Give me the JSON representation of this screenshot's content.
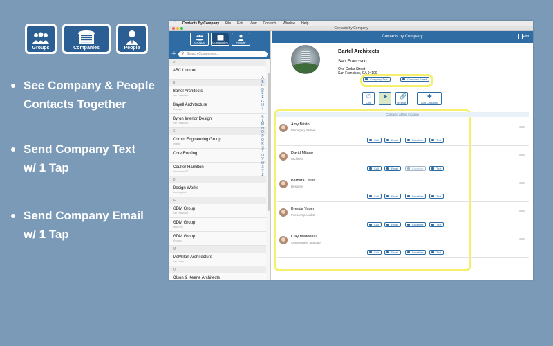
{
  "promo": {
    "icons": [
      {
        "label": "Groups",
        "icon": "groups-icon"
      },
      {
        "label": "Companies",
        "icon": "companies-icon"
      },
      {
        "label": "People",
        "icon": "people-icon"
      }
    ],
    "bullets": [
      {
        "line1": "See Company & People",
        "line2": "Contacts Together"
      },
      {
        "line1": "Send Company Text",
        "line2": "w/ 1 Tap"
      },
      {
        "line1": "Send Company Email",
        "line2": "w/ 1 Tap"
      }
    ]
  },
  "menubar": {
    "app": "Contacts By Company",
    "items": [
      "File",
      "Edit",
      "View",
      "Contacts",
      "Window",
      "Help"
    ]
  },
  "window": {
    "title": "Contacts by Company"
  },
  "sidebar": {
    "segments": [
      {
        "label": "Groups",
        "active": false
      },
      {
        "label": "Companies",
        "active": true
      },
      {
        "label": "People",
        "active": false
      }
    ],
    "search_placeholder": "Search Companies...",
    "list": [
      {
        "type": "section",
        "label": "A"
      },
      {
        "type": "row",
        "name": "ABC Lumber",
        "sub": ""
      },
      {
        "type": "section",
        "label": "B"
      },
      {
        "type": "row",
        "name": "Bartel Architects",
        "sub": "San Francisco"
      },
      {
        "type": "row",
        "name": "Bayell Architecture",
        "sub": "Chicago"
      },
      {
        "type": "row",
        "name": "Byron Interior Design",
        "sub": "San Francisco"
      },
      {
        "type": "section",
        "label": "C"
      },
      {
        "type": "row",
        "name": "Corbin Engineering Group",
        "sub": "Seattle"
      },
      {
        "type": "row",
        "name": "Core Roofing",
        "sub": ""
      },
      {
        "type": "row",
        "name": "Coulter Hamilton",
        "sub": "Vancouver, BC"
      },
      {
        "type": "section",
        "label": "D"
      },
      {
        "type": "row",
        "name": "Design Works",
        "sub": "Los Angeles"
      },
      {
        "type": "section",
        "label": "G"
      },
      {
        "type": "row",
        "name": "GDM Group",
        "sub": "San Francisco"
      },
      {
        "type": "row",
        "name": "GDM Group",
        "sub": "New York"
      },
      {
        "type": "row",
        "name": "GDM Group",
        "sub": "Chicago"
      },
      {
        "type": "section",
        "label": "M"
      },
      {
        "type": "row",
        "name": "McMillan Architecture",
        "sub": "San Diego"
      },
      {
        "type": "section",
        "label": "O"
      },
      {
        "type": "row",
        "name": "Olson & Keene Architects",
        "sub": ""
      }
    ],
    "alpha_index": [
      "A",
      "B",
      "C",
      "D",
      "E",
      "F",
      "G",
      "H",
      "I",
      "J",
      "K",
      "L",
      "M",
      "N",
      "O",
      "P",
      "Q",
      "R",
      "S",
      "T",
      "U",
      "V",
      "W",
      "X",
      "Y",
      "Z"
    ]
  },
  "detail": {
    "header_title": "Contacts by Company",
    "edit_label": "Edit",
    "company_name": "Bartel Architects",
    "city": "San Francisco",
    "address_line1": "One Cedar Street",
    "address_line2": "San Francisco, CA 94109",
    "company_text_label": "Company Text",
    "company_email_label": "Company Email",
    "actions": [
      {
        "label": "Call",
        "icon": "phone-icon"
      },
      {
        "label": "",
        "icon": "map-icon"
      },
      {
        "label": "Website",
        "icon": "link-icon"
      },
      {
        "label": "Add Contacts",
        "icon": "add-person-icon"
      }
    ],
    "contacts_header": "Contacts at this location",
    "contact_buttons": [
      "Call",
      "Email",
      "Facetime",
      "Text"
    ],
    "contacts": [
      {
        "name": "Amy Bristol",
        "title": "Managing Partner"
      },
      {
        "name": "David Milano",
        "title": "Architect"
      },
      {
        "name": "Barbara Onish",
        "title": "Designer"
      },
      {
        "name": "Brenda Yager",
        "title": "Interior Specialist"
      },
      {
        "name": "Clay Medenhall",
        "title": "Construction Manager"
      }
    ]
  },
  "colors": {
    "background": "#7a9ab8",
    "brand": "#2f6ca3",
    "highlight": "#f6ef6e"
  }
}
